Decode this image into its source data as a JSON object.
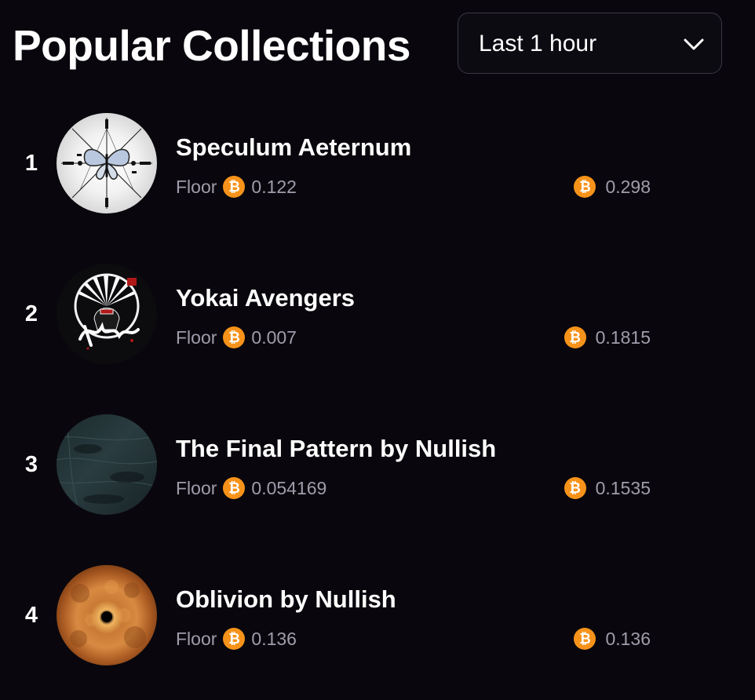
{
  "header": {
    "title": "Popular Collections",
    "timeframe": {
      "selected": "Last 1 hour",
      "icon": "chevron-down-icon"
    }
  },
  "currency_icon": "bitcoin-icon",
  "currency_symbol": "₿",
  "colors": {
    "background": "#09070d",
    "bitcoin": "#f7931a",
    "muted_text": "#a19cab",
    "border": "#3a3644"
  },
  "collections": [
    {
      "rank": "1",
      "name": "Speculum Aeternum",
      "floor_label": "Floor",
      "floor_price": "0.122",
      "volume": "0.298"
    },
    {
      "rank": "2",
      "name": "Yokai Avengers",
      "floor_label": "Floor",
      "floor_price": "0.007",
      "volume": "0.1815"
    },
    {
      "rank": "3",
      "name": "The Final Pattern by Nullish",
      "floor_label": "Floor",
      "floor_price": "0.054169",
      "volume": "0.1535"
    },
    {
      "rank": "4",
      "name": "Oblivion by Nullish",
      "floor_label": "Floor",
      "floor_price": "0.136",
      "volume": "0.136"
    }
  ]
}
